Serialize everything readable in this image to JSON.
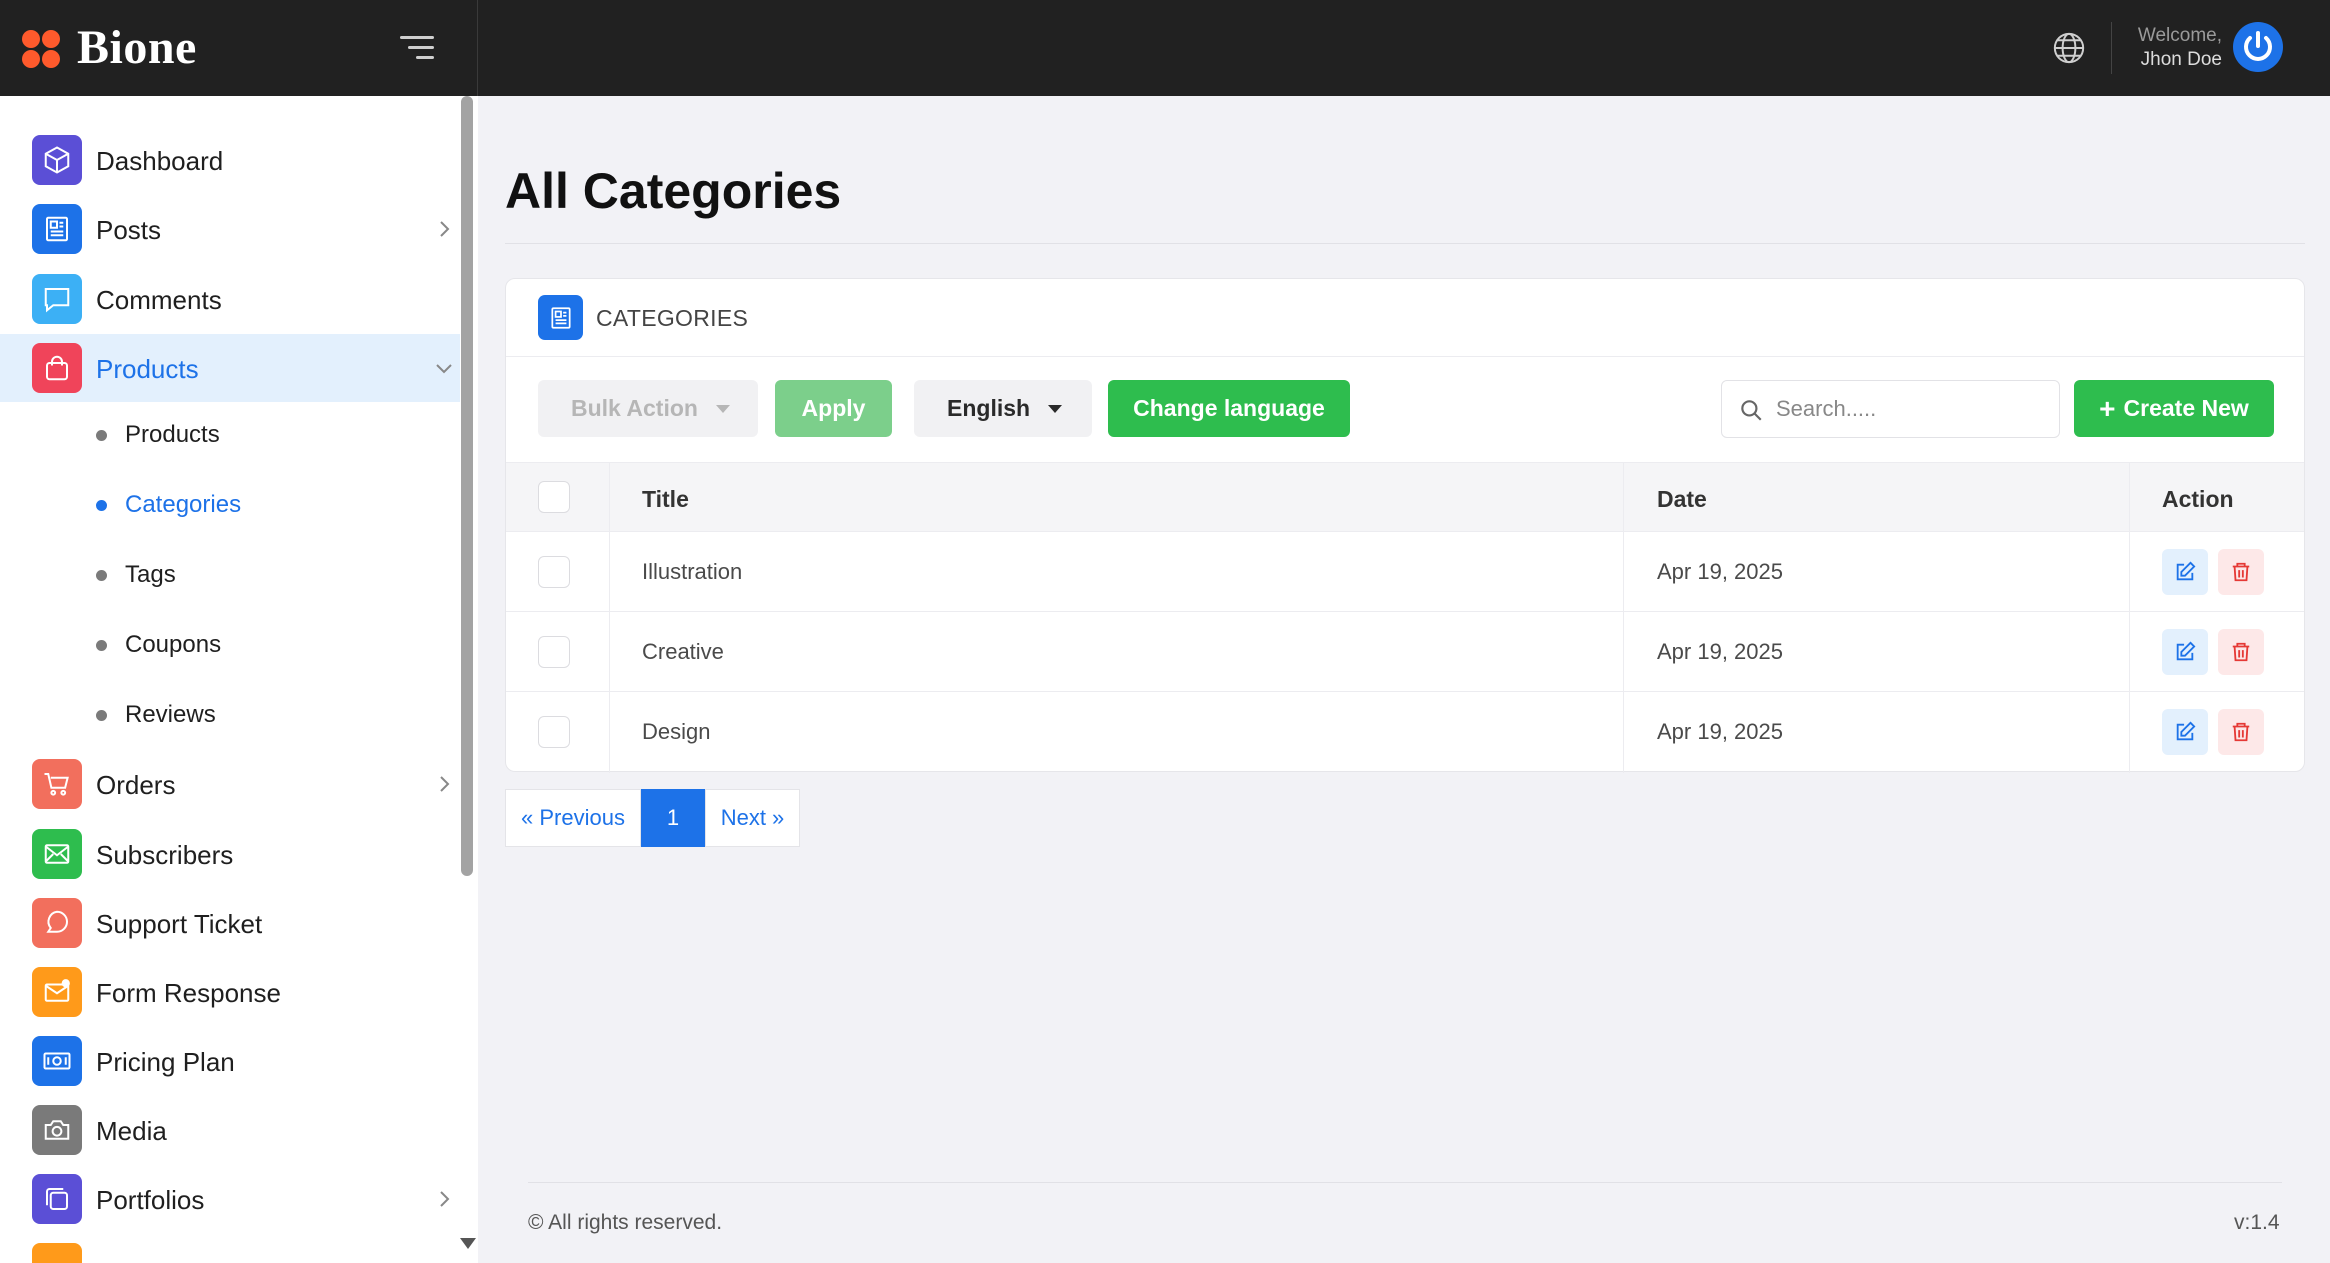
{
  "app": {
    "name": "Bione"
  },
  "header": {
    "welcome_label": "Welcome,",
    "user_name": "Jhon Doe"
  },
  "sidebar": {
    "items": [
      {
        "label": "Dashboard",
        "icon": "cube-icon",
        "color": "#5b4fd6"
      },
      {
        "label": "Posts",
        "icon": "newspaper-icon",
        "color": "#1d72e8"
      },
      {
        "label": "Comments",
        "icon": "comment-icon",
        "color": "#3cb0f5"
      },
      {
        "label": "Products",
        "icon": "shopping-bag-icon",
        "color": "#f0445a"
      },
      {
        "label": "Orders",
        "icon": "cart-icon",
        "color": "#f26f5d"
      },
      {
        "label": "Subscribers",
        "icon": "mail-icon",
        "color": "#2ebd4e"
      },
      {
        "label": "Support Ticket",
        "icon": "chat-icon",
        "color": "#f26f5d"
      },
      {
        "label": "Form Response",
        "icon": "envelope-notify-icon",
        "color": "#ff9a1a"
      },
      {
        "label": "Pricing Plan",
        "icon": "money-icon",
        "color": "#1d72e8"
      },
      {
        "label": "Media",
        "icon": "camera-icon",
        "color": "#7a7a7a"
      },
      {
        "label": "Portfolios",
        "icon": "layers-icon",
        "color": "#5b4fd6"
      }
    ],
    "sub_items": [
      {
        "label": "Products"
      },
      {
        "label": "Categories"
      },
      {
        "label": "Tags"
      },
      {
        "label": "Coupons"
      },
      {
        "label": "Reviews"
      }
    ]
  },
  "main": {
    "page_title": "All Categories",
    "card_title": "CATEGORIES",
    "toolbar": {
      "bulk_action": "Bulk Action",
      "apply": "Apply",
      "language": "English",
      "change_language": "Change language",
      "search_placeholder": "Search.....",
      "create_new": "Create New"
    },
    "table": {
      "columns": [
        "Title",
        "Date",
        "Action"
      ],
      "rows": [
        {
          "title": "Illustration",
          "date": "Apr 19, 2025"
        },
        {
          "title": "Creative",
          "date": "Apr 19, 2025"
        },
        {
          "title": "Design",
          "date": "Apr 19, 2025"
        }
      ]
    },
    "pagination": {
      "previous": "« Previous",
      "current": "1",
      "next": "Next »"
    }
  },
  "footer": {
    "copyright": "© All rights reserved.",
    "version": "v:1.4"
  },
  "colors": {
    "accent": "#1d72e8",
    "success": "#2ebd4e",
    "danger": "#e53935",
    "topbar": "#212121",
    "logo": "#ff5a2c"
  }
}
